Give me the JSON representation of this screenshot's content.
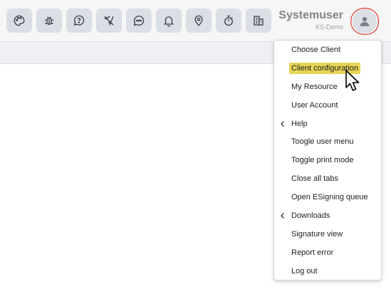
{
  "header": {
    "toolbar_icons": [
      {
        "icon": "palette-icon"
      },
      {
        "icon": "bug-icon"
      },
      {
        "icon": "help-chat-icon"
      },
      {
        "icon": "location-off-icon"
      },
      {
        "icon": "chat-icon"
      },
      {
        "icon": "bell-icon"
      },
      {
        "icon": "map-pin-icon"
      },
      {
        "icon": "stopwatch-icon"
      },
      {
        "icon": "building-icon"
      }
    ],
    "user_name": "Systemuser",
    "user_subtitle": "KS-Demo",
    "avatar_icon": "user-icon"
  },
  "user_menu": {
    "active_item": "Client configuration",
    "items": [
      {
        "label": "Choose Client"
      },
      {
        "label": "Client configuration"
      },
      {
        "label": "My Resource"
      },
      {
        "label": "User Account"
      },
      {
        "label": "Help"
      },
      {
        "label": "Toogle user menu"
      },
      {
        "label": "Toggle print mode"
      },
      {
        "label": "Close all tabs"
      },
      {
        "label": "Open ESigning queue"
      },
      {
        "label": "Downloads"
      },
      {
        "label": "Signature view"
      },
      {
        "label": "Report error"
      },
      {
        "label": "Log out"
      }
    ]
  },
  "colors": {
    "highlight": "#e7d455",
    "annotation_ring": "#e0463a"
  }
}
